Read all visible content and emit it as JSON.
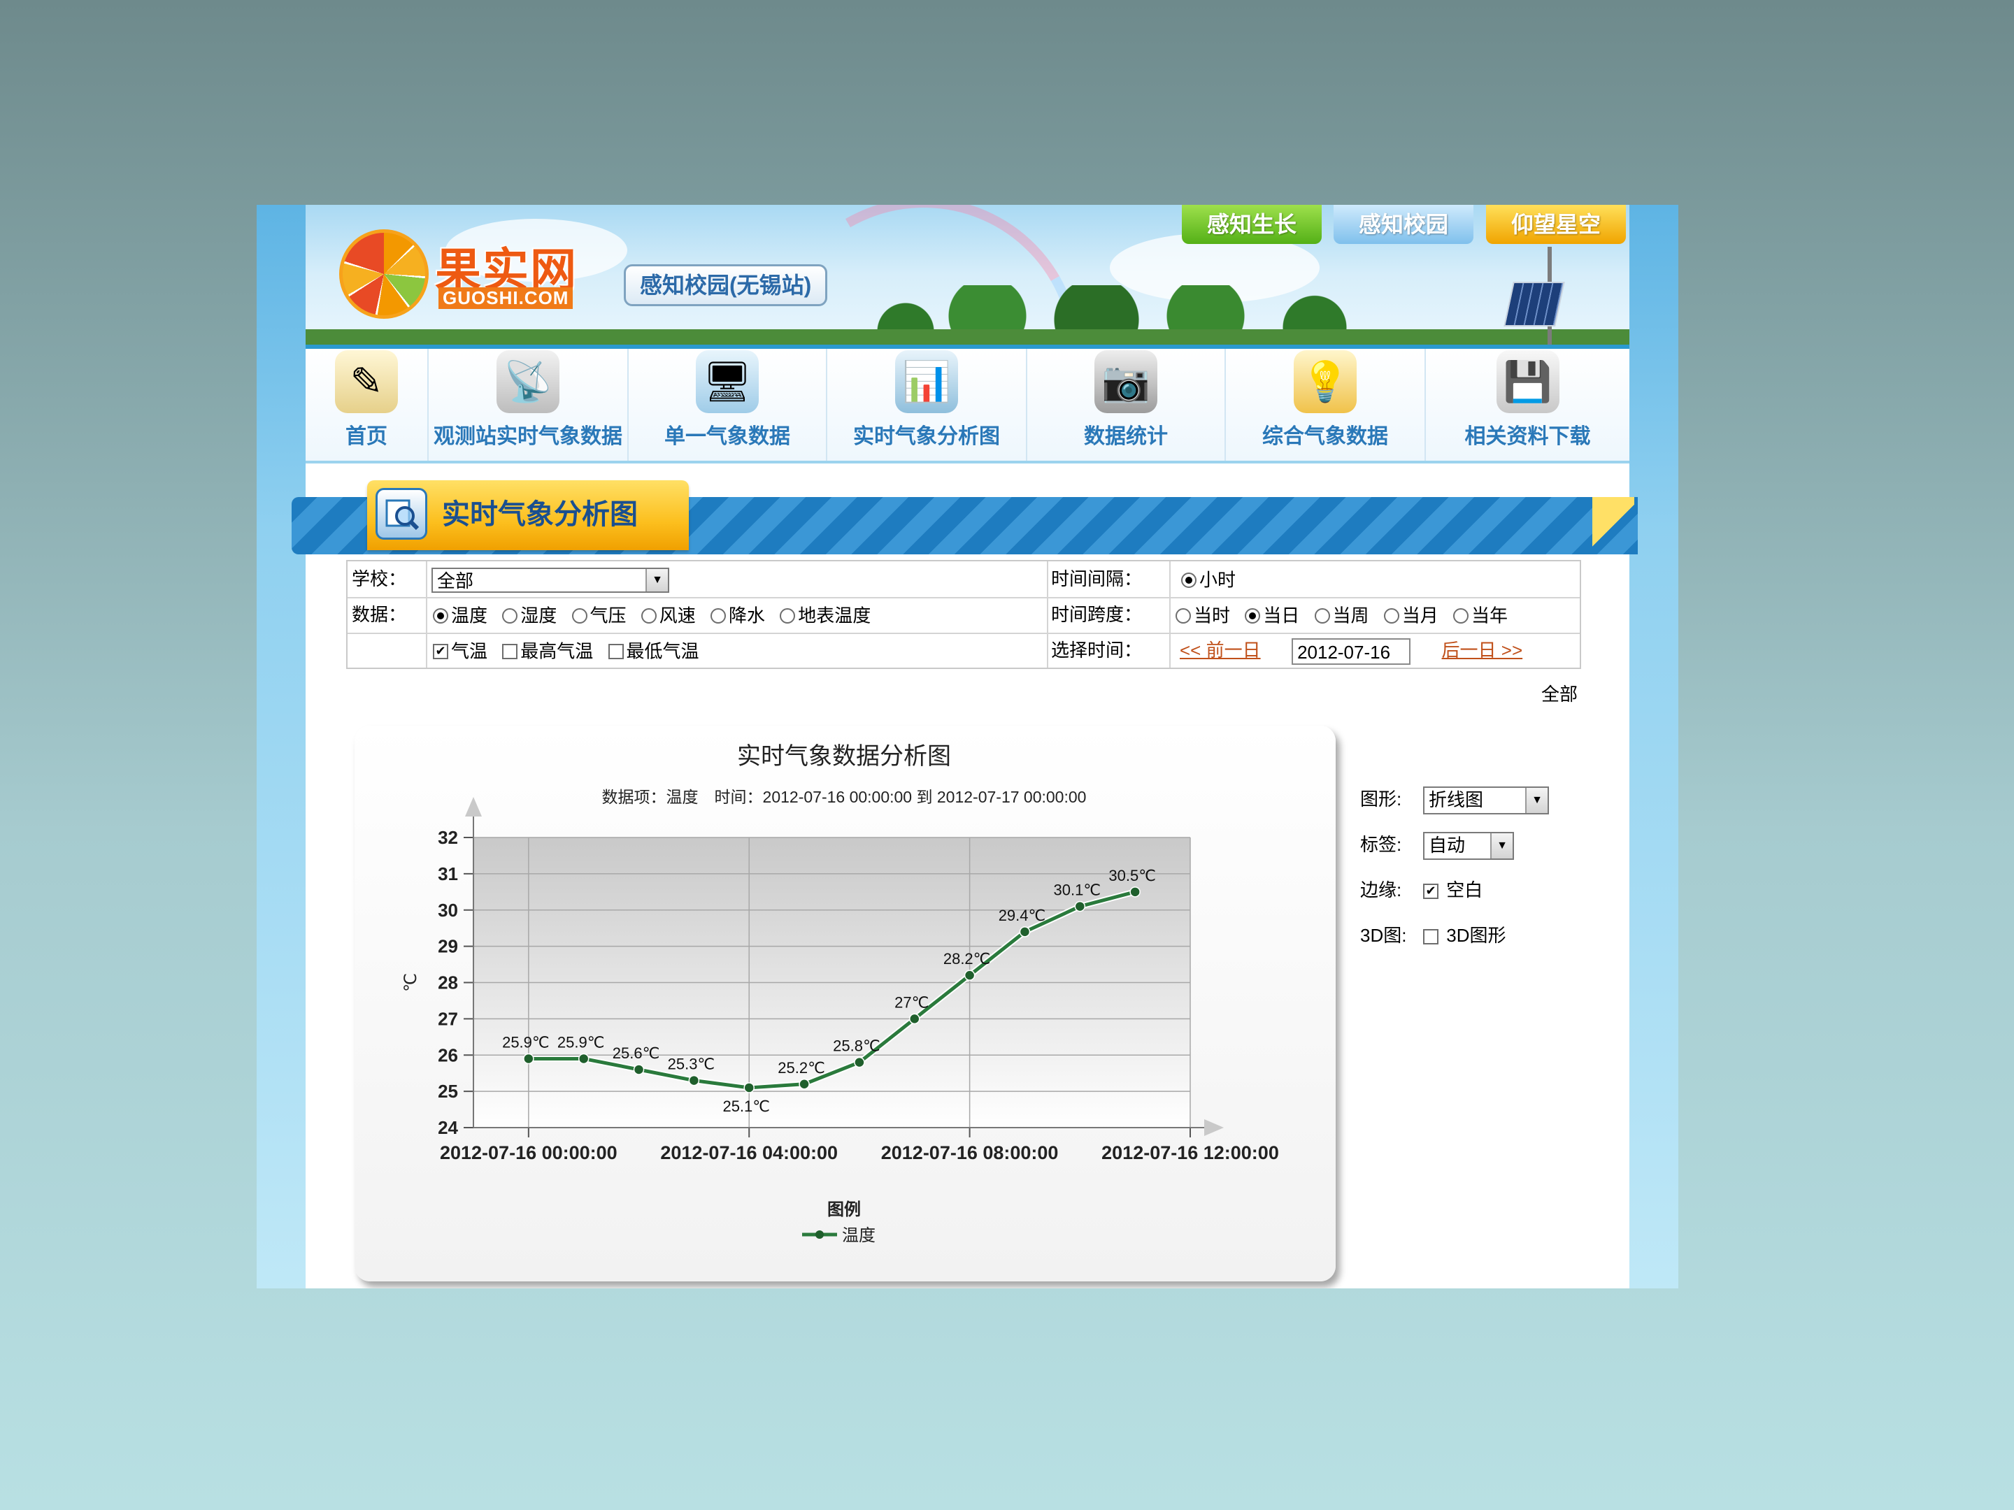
{
  "header": {
    "logo_text": "果实网",
    "logo_sub": "GUOSHI.COM",
    "station_badge": "感知校园(无锡站)",
    "top_tabs": [
      "感知生长",
      "感知校园",
      "仰望星空"
    ]
  },
  "nav": {
    "items": [
      {
        "label": "首页",
        "icon": "✎"
      },
      {
        "label": "观测站实时气象数据",
        "icon": "📡"
      },
      {
        "label": "单一气象数据",
        "icon": "🖥"
      },
      {
        "label": "实时气象分析图",
        "icon": "📊"
      },
      {
        "label": "数据统计",
        "icon": "📷"
      },
      {
        "label": "综合气象数据",
        "icon": "💡"
      },
      {
        "label": "相关资料下载",
        "icon": "💾"
      }
    ]
  },
  "section": {
    "title": "实时气象分析图"
  },
  "filters": {
    "school_label": "学校：",
    "school_value": "全部",
    "data_label": "数据：",
    "data_options": [
      {
        "label": "温度",
        "checked": true
      },
      {
        "label": "湿度",
        "checked": false
      },
      {
        "label": "气压",
        "checked": false
      },
      {
        "label": "风速",
        "checked": false
      },
      {
        "label": "降水",
        "checked": false
      },
      {
        "label": "地表温度",
        "checked": false
      }
    ],
    "temp_options": [
      {
        "label": "气温",
        "checked": true
      },
      {
        "label": "最高气温",
        "checked": false
      },
      {
        "label": "最低气温",
        "checked": false
      }
    ],
    "interval_label": "时间间隔：",
    "interval_options": [
      {
        "label": "小时",
        "checked": true
      }
    ],
    "span_label": "时间跨度：",
    "span_options": [
      {
        "label": "当时",
        "checked": false
      },
      {
        "label": "当日",
        "checked": true
      },
      {
        "label": "当周",
        "checked": false
      },
      {
        "label": "当月",
        "checked": false
      },
      {
        "label": "当年",
        "checked": false
      }
    ],
    "select_time_label": "选择时间：",
    "prev_day": "<< 前一日",
    "date_value": "2012-07-16",
    "next_day": "后一日 >>",
    "all_link": "全部"
  },
  "options_panel": {
    "shape_label": "图形:",
    "shape_value": "折线图",
    "tag_label": "标签:",
    "tag_value": "自动",
    "margin_label": "边缘:",
    "margin_option": "空白",
    "margin_checked": true,
    "d3_label": "3D图:",
    "d3_option": "3D图形",
    "d3_checked": false
  },
  "chart_data": {
    "type": "line",
    "title": "实时气象数据分析图",
    "subtitle": "数据项：温度　时间：2012-07-16 00:00:00 到 2012-07-17 00:00:00",
    "ylabel": "℃",
    "ylim": [
      24,
      32
    ],
    "y_ticks": [
      24,
      25,
      26,
      27,
      28,
      29,
      30,
      31,
      32
    ],
    "x_range_hours": [
      -1,
      12
    ],
    "x_ticks": [
      {
        "hour": 0,
        "label": "2012-07-16 00:00:00"
      },
      {
        "hour": 4,
        "label": "2012-07-16 04:00:00"
      },
      {
        "hour": 8,
        "label": "2012-07-16 08:00:00"
      },
      {
        "hour": 12,
        "label": "2012-07-16 12:00:00"
      }
    ],
    "legend_title": "图例",
    "legend_placement": "bottom",
    "color": "#2a7a3c",
    "grid": true,
    "series": [
      {
        "name": "温度",
        "x": [
          0,
          1,
          2,
          3,
          4,
          5,
          6,
          7,
          8,
          9,
          10,
          11
        ],
        "values": [
          25.9,
          25.9,
          25.6,
          25.3,
          25.1,
          25.2,
          25.8,
          27,
          28.2,
          29.4,
          30.1,
          30.5
        ],
        "labels": [
          "25.9℃",
          "25.9℃",
          "25.6℃",
          "25.3℃",
          "25.1℃",
          "25.2℃",
          "25.8℃",
          "27℃",
          "28.2℃",
          "29.4℃",
          "30.1℃",
          "30.5℃"
        ]
      }
    ]
  }
}
